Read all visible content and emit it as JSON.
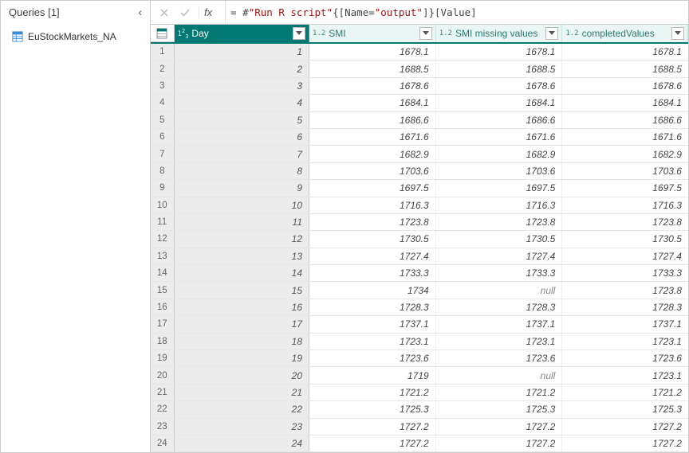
{
  "sidebar": {
    "title": "Queries [1]",
    "items": [
      {
        "label": "EuStockMarkets_NA"
      }
    ]
  },
  "formula_bar": {
    "fx_label": "fx",
    "formula_prefix": "= #",
    "formula_str1": "\"Run R script\"",
    "formula_mid": "{[Name=",
    "formula_str2": "\"output\"",
    "formula_suffix": "]}[Value]"
  },
  "columns": [
    {
      "type_label": "1²₃",
      "name": "Day",
      "variant": "dark"
    },
    {
      "type_label": "1.2",
      "name": "SMI",
      "variant": "light"
    },
    {
      "type_label": "1.2",
      "name": "SMI missing values",
      "variant": "light"
    },
    {
      "type_label": "1.2",
      "name": "completedValues",
      "variant": "light"
    }
  ],
  "chart_data": {
    "type": "table",
    "columns": [
      "Day",
      "SMI",
      "SMI missing values",
      "completedValues"
    ],
    "rows": [
      {
        "n": 1,
        "day": 1,
        "smi": "1678.1",
        "miss": "1678.1",
        "comp": "1678.1"
      },
      {
        "n": 2,
        "day": 2,
        "smi": "1688.5",
        "miss": "1688.5",
        "comp": "1688.5"
      },
      {
        "n": 3,
        "day": 3,
        "smi": "1678.6",
        "miss": "1678.6",
        "comp": "1678.6"
      },
      {
        "n": 4,
        "day": 4,
        "smi": "1684.1",
        "miss": "1684.1",
        "comp": "1684.1"
      },
      {
        "n": 5,
        "day": 5,
        "smi": "1686.6",
        "miss": "1686.6",
        "comp": "1686.6"
      },
      {
        "n": 6,
        "day": 6,
        "smi": "1671.6",
        "miss": "1671.6",
        "comp": "1671.6"
      },
      {
        "n": 7,
        "day": 7,
        "smi": "1682.9",
        "miss": "1682.9",
        "comp": "1682.9"
      },
      {
        "n": 8,
        "day": 8,
        "smi": "1703.6",
        "miss": "1703.6",
        "comp": "1703.6"
      },
      {
        "n": 9,
        "day": 9,
        "smi": "1697.5",
        "miss": "1697.5",
        "comp": "1697.5"
      },
      {
        "n": 10,
        "day": 10,
        "smi": "1716.3",
        "miss": "1716.3",
        "comp": "1716.3"
      },
      {
        "n": 11,
        "day": 11,
        "smi": "1723.8",
        "miss": "1723.8",
        "comp": "1723.8"
      },
      {
        "n": 12,
        "day": 12,
        "smi": "1730.5",
        "miss": "1730.5",
        "comp": "1730.5"
      },
      {
        "n": 13,
        "day": 13,
        "smi": "1727.4",
        "miss": "1727.4",
        "comp": "1727.4"
      },
      {
        "n": 14,
        "day": 14,
        "smi": "1733.3",
        "miss": "1733.3",
        "comp": "1733.3"
      },
      {
        "n": 15,
        "day": 15,
        "smi": "1734",
        "miss": "null",
        "comp": "1723.8"
      },
      {
        "n": 16,
        "day": 16,
        "smi": "1728.3",
        "miss": "1728.3",
        "comp": "1728.3"
      },
      {
        "n": 17,
        "day": 17,
        "smi": "1737.1",
        "miss": "1737.1",
        "comp": "1737.1"
      },
      {
        "n": 18,
        "day": 18,
        "smi": "1723.1",
        "miss": "1723.1",
        "comp": "1723.1"
      },
      {
        "n": 19,
        "day": 19,
        "smi": "1723.6",
        "miss": "1723.6",
        "comp": "1723.6"
      },
      {
        "n": 20,
        "day": 20,
        "smi": "1719",
        "miss": "null",
        "comp": "1723.1"
      },
      {
        "n": 21,
        "day": 21,
        "smi": "1721.2",
        "miss": "1721.2",
        "comp": "1721.2"
      },
      {
        "n": 22,
        "day": 22,
        "smi": "1725.3",
        "miss": "1725.3",
        "comp": "1725.3"
      },
      {
        "n": 23,
        "day": 23,
        "smi": "1727.2",
        "miss": "1727.2",
        "comp": "1727.2"
      },
      {
        "n": 24,
        "day": 24,
        "smi": "1727.2",
        "miss": "1727.2",
        "comp": "1727.2"
      }
    ]
  }
}
